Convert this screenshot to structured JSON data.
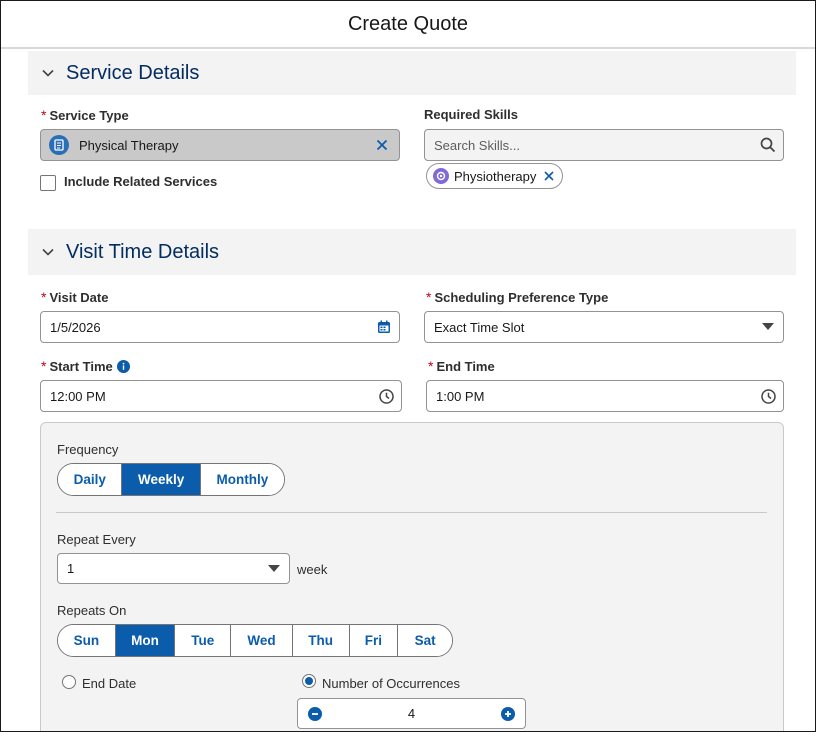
{
  "modal": {
    "title": "Create Quote"
  },
  "service_details": {
    "section_title": "Service Details",
    "service_type": {
      "label": "Service Type",
      "value": "Physical Therapy"
    },
    "include_related": {
      "label": "Include Related Services",
      "checked": false
    },
    "required_skills": {
      "label": "Required Skills",
      "placeholder": "Search Skills...",
      "pill": "Physiotherapy"
    }
  },
  "visit_time_details": {
    "section_title": "Visit Time Details",
    "visit_date": {
      "label": "Visit Date",
      "value": "1/5/2026"
    },
    "scheduling_preference": {
      "label": "Scheduling Preference Type",
      "value": "Exact Time Slot"
    },
    "start_time": {
      "label": "Start Time",
      "value": "12:00 PM"
    },
    "end_time": {
      "label": "End Time",
      "value": "1:00 PM"
    }
  },
  "recurrence": {
    "frequency_label": "Frequency",
    "frequency_options": [
      "Daily",
      "Weekly",
      "Monthly"
    ],
    "frequency_selected": "Weekly",
    "repeat_every_label": "Repeat Every",
    "repeat_every_value": "1",
    "repeat_every_unit": "week",
    "repeats_on_label": "Repeats On",
    "days": [
      "Sun",
      "Mon",
      "Tue",
      "Wed",
      "Thu",
      "Fri",
      "Sat"
    ],
    "days_selected": [
      "Mon"
    ],
    "end_date_label": "End Date",
    "occurrences_label": "Number of Occurrences",
    "occurrences_value": "4",
    "end_option_selected": "Number of Occurrences"
  },
  "colors": {
    "brand": "#0b5cab",
    "required": "#ba0517",
    "section_title": "#032d60"
  }
}
